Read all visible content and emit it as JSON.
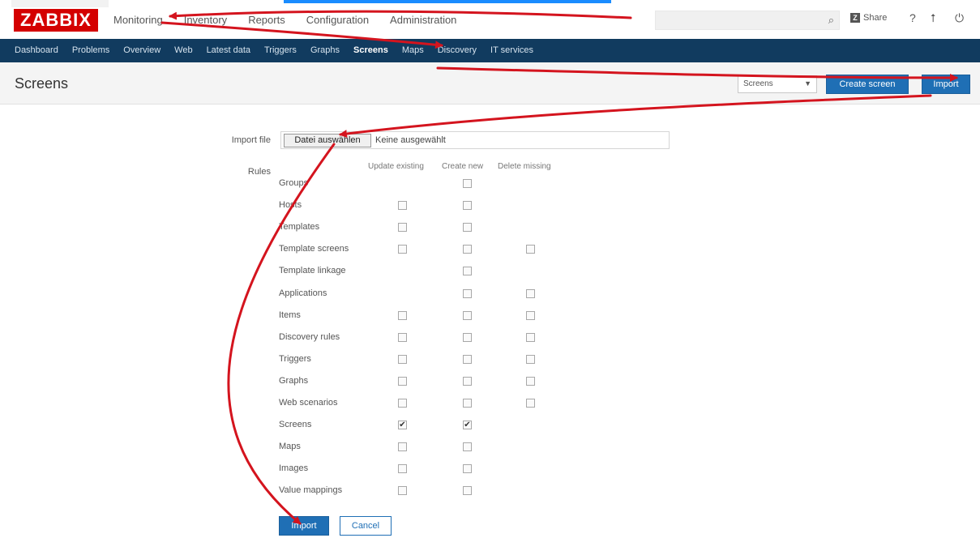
{
  "header": {
    "logo": "ZABBIX",
    "nav": [
      "Monitoring",
      "Inventory",
      "Reports",
      "Configuration",
      "Administration"
    ],
    "share_label": "Share",
    "help_glyph": "?",
    "user_glyph": "⭡",
    "logout_glyph": "⏻",
    "search_glyph": "⌕"
  },
  "subnav": {
    "items": [
      "Dashboard",
      "Problems",
      "Overview",
      "Web",
      "Latest data",
      "Triggers",
      "Graphs",
      "Screens",
      "Maps",
      "Discovery",
      "IT services"
    ],
    "active": "Screens"
  },
  "titlebar": {
    "title": "Screens",
    "select_value": "Screens",
    "create_label": "Create screen",
    "import_label": "Import"
  },
  "form": {
    "import_file_label": "Import file",
    "file_button": "Datei auswählen",
    "file_status": "Keine ausgewählt",
    "rules_label": "Rules",
    "columns": [
      "Update existing",
      "Create new",
      "Delete missing"
    ],
    "rules": [
      {
        "label": "Groups",
        "update": null,
        "create": false,
        "delete": null
      },
      {
        "label": "Hosts",
        "update": false,
        "create": false,
        "delete": null
      },
      {
        "label": "Templates",
        "update": false,
        "create": false,
        "delete": null
      },
      {
        "label": "Template screens",
        "update": false,
        "create": false,
        "delete": false
      },
      {
        "label": "Template linkage",
        "update": null,
        "create": false,
        "delete": null
      },
      {
        "label": "Applications",
        "update": null,
        "create": false,
        "delete": false
      },
      {
        "label": "Items",
        "update": false,
        "create": false,
        "delete": false
      },
      {
        "label": "Discovery rules",
        "update": false,
        "create": false,
        "delete": false
      },
      {
        "label": "Triggers",
        "update": false,
        "create": false,
        "delete": false
      },
      {
        "label": "Graphs",
        "update": false,
        "create": false,
        "delete": false
      },
      {
        "label": "Web scenarios",
        "update": false,
        "create": false,
        "delete": false
      },
      {
        "label": "Screens",
        "update": true,
        "create": true,
        "delete": null
      },
      {
        "label": "Maps",
        "update": false,
        "create": false,
        "delete": null
      },
      {
        "label": "Images",
        "update": false,
        "create": false,
        "delete": null
      },
      {
        "label": "Value mappings",
        "update": false,
        "create": false,
        "delete": null
      }
    ],
    "import_button": "Import",
    "cancel_button": "Cancel"
  },
  "colors": {
    "brand": "#d40000",
    "subnav": "#113b5f",
    "primary": "#1f6fb5",
    "annotation": "#d4141e"
  }
}
